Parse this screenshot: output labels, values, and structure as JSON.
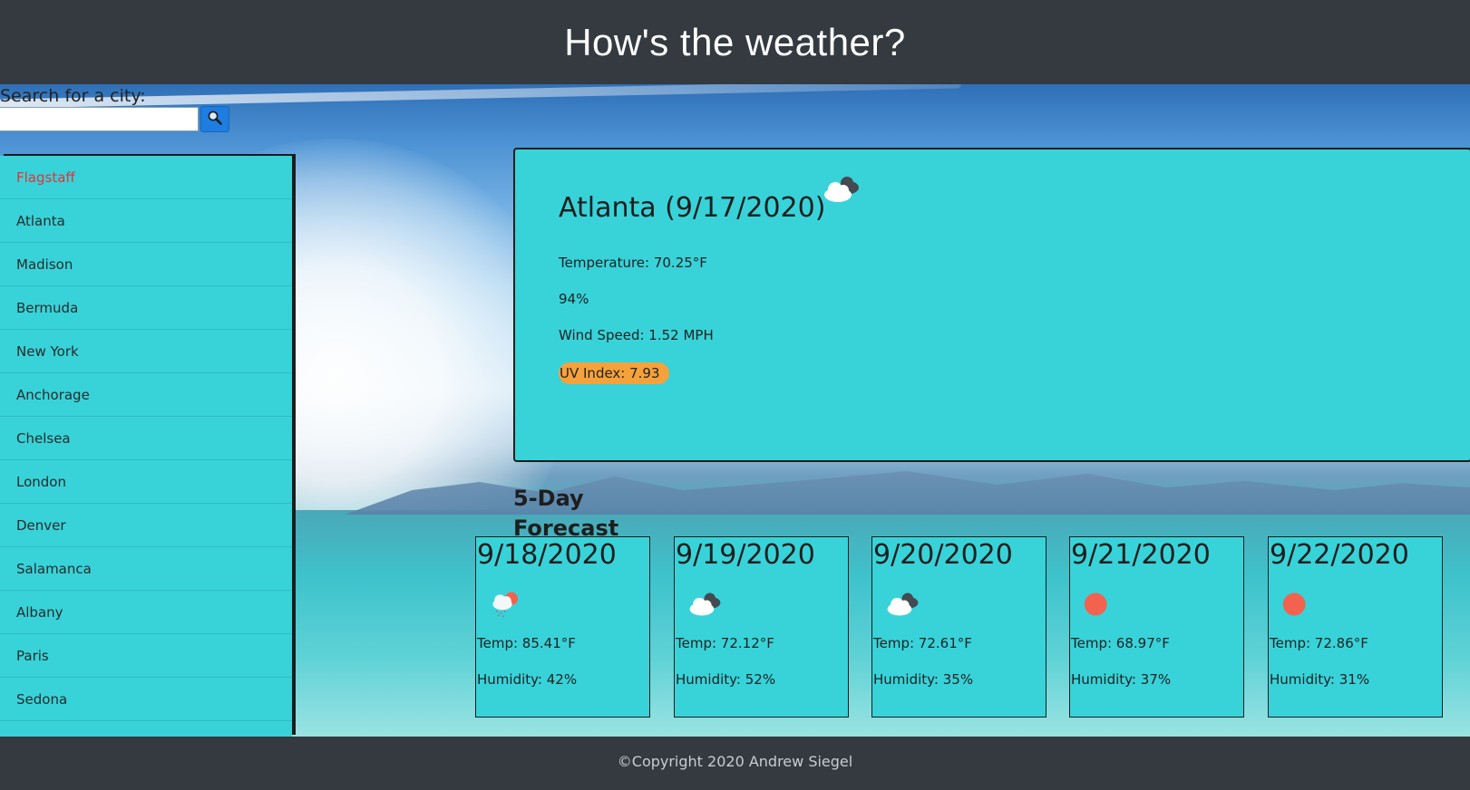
{
  "header": {
    "title": "How's the weather?"
  },
  "search": {
    "label": "Search for a city:",
    "value": "",
    "placeholder": "",
    "button_icon": "search-icon"
  },
  "cities": [
    {
      "name": "Flagstaff",
      "active": true
    },
    {
      "name": "Atlanta",
      "active": false
    },
    {
      "name": "Madison",
      "active": false
    },
    {
      "name": "Bermuda",
      "active": false
    },
    {
      "name": "New York",
      "active": false
    },
    {
      "name": "Anchorage",
      "active": false
    },
    {
      "name": "Chelsea",
      "active": false
    },
    {
      "name": "London",
      "active": false
    },
    {
      "name": "Denver",
      "active": false
    },
    {
      "name": "Salamanca",
      "active": false
    },
    {
      "name": "Albany",
      "active": false
    },
    {
      "name": "Paris",
      "active": false
    },
    {
      "name": "Sedona",
      "active": false
    }
  ],
  "current": {
    "title": "Atlanta (9/17/2020)",
    "icon": "broken-clouds-icon",
    "temperature": "Temperature: 70.25°F",
    "humidity": "94%",
    "wind": "Wind Speed: 1.52 MPH",
    "uv": "UV Index: 7.93"
  },
  "forecast_heading": "5-Day Forecast",
  "forecast": [
    {
      "date": "9/18/2020",
      "icon": "rain-icon",
      "temp": "Temp: 85.41°F",
      "humidity": "Humidity: 42%"
    },
    {
      "date": "9/19/2020",
      "icon": "broken-clouds-icon",
      "temp": "Temp: 72.12°F",
      "humidity": "Humidity: 52%"
    },
    {
      "date": "9/20/2020",
      "icon": "broken-clouds-icon",
      "temp": "Temp: 72.61°F",
      "humidity": "Humidity: 35%"
    },
    {
      "date": "9/21/2020",
      "icon": "clear-sky-icon",
      "temp": "Temp: 68.97°F",
      "humidity": "Humidity: 37%"
    },
    {
      "date": "9/22/2020",
      "icon": "clear-sky-icon",
      "temp": "Temp: 72.86°F",
      "humidity": "Humidity: 31%"
    }
  ],
  "colors": {
    "card": "#37d3d9",
    "header": "#343a40",
    "uv_badge": "#f6a23a",
    "active_city": "#e2343a",
    "sun": "#f2624f"
  },
  "footer": {
    "text": "©Copyright 2020 Andrew Siegel"
  }
}
